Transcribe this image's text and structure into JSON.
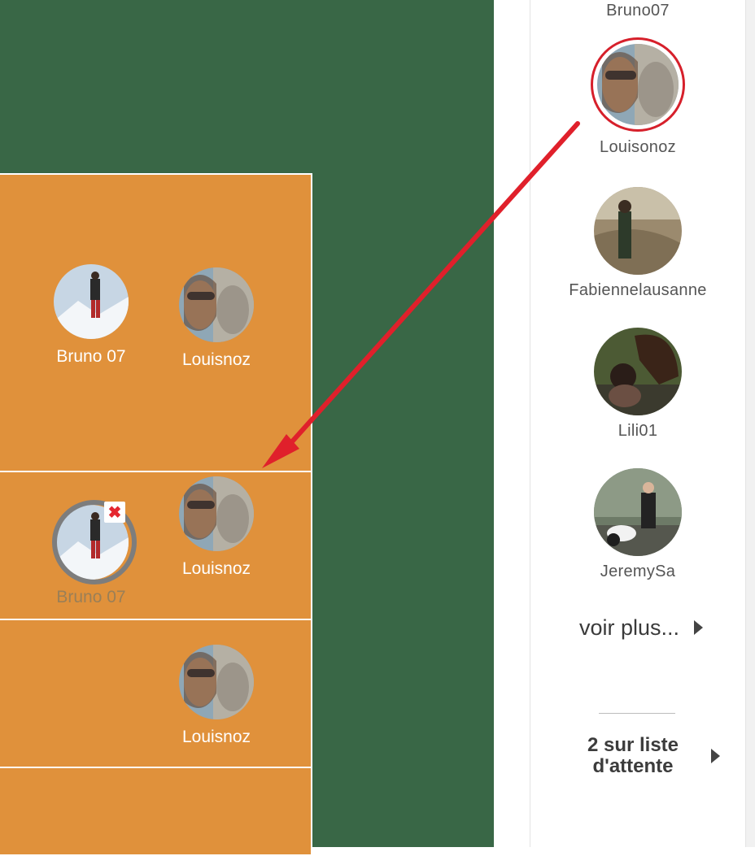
{
  "sidebar": {
    "members": [
      {
        "name": "Bruno07"
      },
      {
        "name": "Louisonoz"
      },
      {
        "name": "Fabiennelausanne"
      },
      {
        "name": "Lili01"
      },
      {
        "name": "JeremySa"
      }
    ],
    "more_label": "voir plus...",
    "waitlist_line1": "2 sur liste",
    "waitlist_line2": "d'attente"
  },
  "board": {
    "slots": [
      {
        "players": [
          {
            "name": "Bruno 07"
          },
          {
            "name": "Louisnoz"
          }
        ]
      },
      {
        "players": [
          {
            "name": "Bruno 07",
            "state": "pending-removal"
          },
          {
            "name": "Louisnoz"
          }
        ]
      },
      {
        "players": [
          {
            "name": "Louisnoz"
          }
        ]
      },
      {
        "players": []
      }
    ]
  },
  "colors": {
    "background_green": "#396746",
    "slot_orange": "#e0913b",
    "highlight_red": "#d6202b"
  },
  "icons": {
    "remove": "close-icon",
    "more": "caret-right-icon",
    "drag_hint": "red-arrow"
  }
}
